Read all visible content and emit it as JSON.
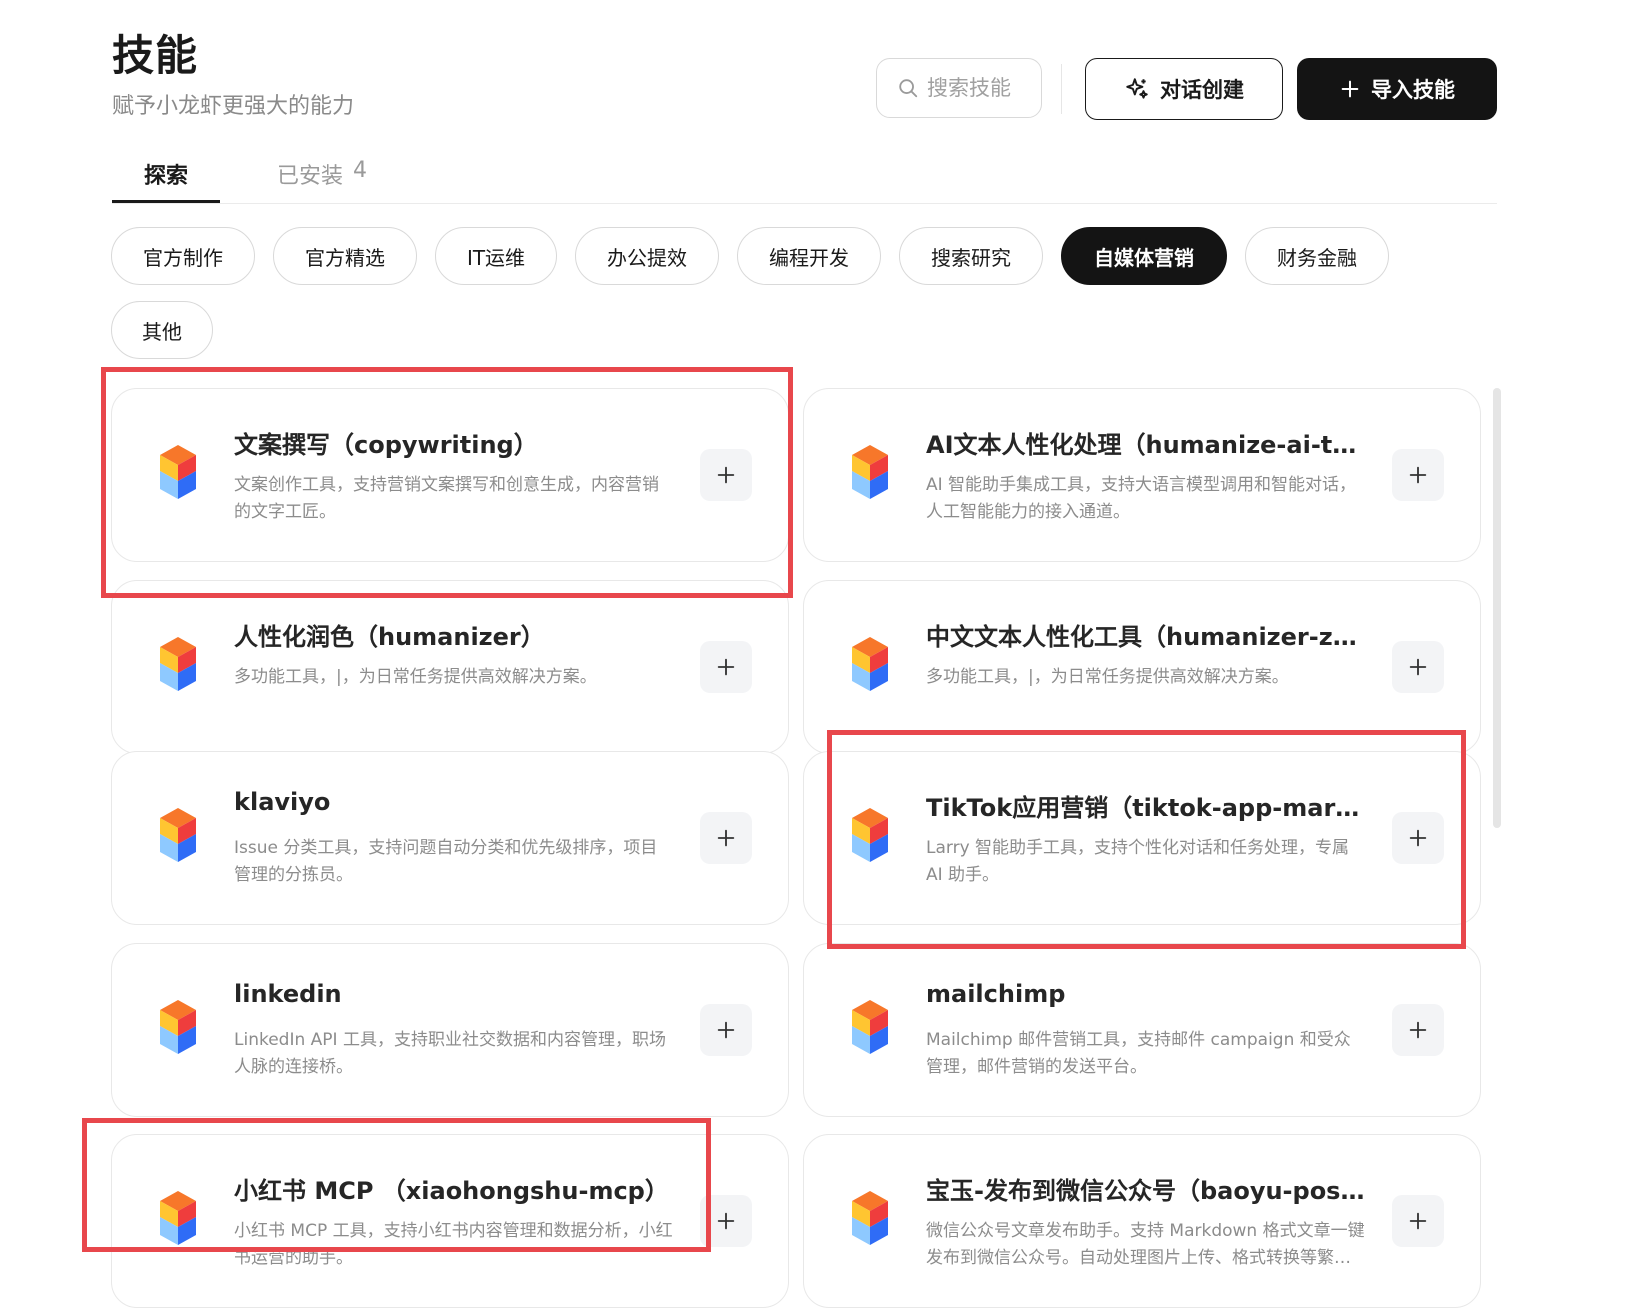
{
  "header": {
    "title": "技能",
    "subtitle": "赋予小龙虾更强大的能力",
    "search_placeholder": "搜索技能",
    "chat_create_label": "对话创建",
    "import_label": "导入技能"
  },
  "tabs": {
    "explore": "探索",
    "installed": "已安装",
    "installed_count": "4"
  },
  "categories": [
    "官方制作",
    "官方精选",
    "IT运维",
    "办公提效",
    "编程开发",
    "搜索研究",
    "自媒体营销",
    "财务金融",
    "其他"
  ],
  "active_category": "自媒体营销",
  "skills": [
    {
      "title": "文案撰写（copywriting）",
      "desc": "文案创作工具，支持营销文案撰写和创意生成，内容营销的文字工匠。"
    },
    {
      "title": "AI文本人性化处理（humanize-ai-text）",
      "desc": "AI 智能助手集成工具，支持大语言模型调用和智能对话，人工智能能力的接入通道。"
    },
    {
      "title": "人性化润色（humanizer）",
      "desc": "多功能工具，|，为日常任务提供高效解决方案。"
    },
    {
      "title": "中文文本人性化工具（humanizer-zh）",
      "desc": "多功能工具，|，为日常任务提供高效解决方案。"
    },
    {
      "title": "klaviyo",
      "desc": "Issue 分类工具，支持问题自动分类和优先级排序，项目管理的分拣员。"
    },
    {
      "title": "TikTok应用营销（tiktok-app-marketing）",
      "desc": "Larry 智能助手工具，支持个性化对话和任务处理，专属 AI 助手。"
    },
    {
      "title": "linkedin",
      "desc": "LinkedIn API 工具，支持职业社交数据和内容管理，职场人脉的连接桥。"
    },
    {
      "title": "mailchimp",
      "desc": "Mailchimp 邮件营销工具，支持邮件 campaign 和受众管理，邮件营销的发送平台。"
    },
    {
      "title": "小红书 MCP （xiaohongshu-mcp）",
      "desc": "小红书 MCP 工具，支持小红书内容管理和数据分析，小红书运营的助手。"
    },
    {
      "title": "宝玉-发布到微信公众号（baoyu-post-to-wechat）",
      "desc": "微信公众号文章发布助手。支持 Markdown 格式文章一键发布到微信公众号。自动处理图片上传、格式转换等繁琐操作。"
    }
  ],
  "colors": {
    "primary": "#141414",
    "annotation": "#e8474c",
    "logo_orange": "#f7772a",
    "logo_yellow": "#ffc531",
    "logo_red": "#ef3d3d",
    "logo_blue": "#2f6cf6",
    "logo_lightblue": "#8ec9ff"
  }
}
